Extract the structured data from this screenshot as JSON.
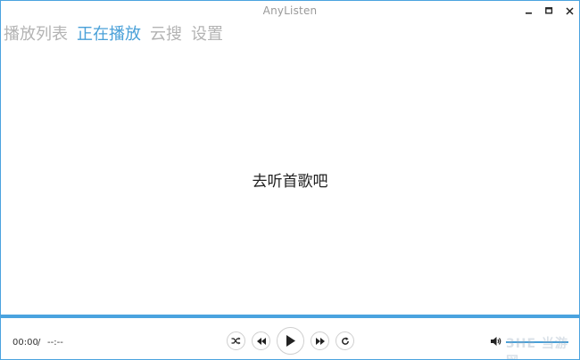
{
  "window": {
    "title": "AnyListen",
    "accent_color": "#4aa3df"
  },
  "controls": {
    "minimize_icon": "minimize-icon",
    "maximize_icon": "maximize-icon",
    "close_icon": "close-icon"
  },
  "tabs": [
    {
      "label": "播放列表",
      "active": false
    },
    {
      "label": "正在播放",
      "active": true
    },
    {
      "label": "云搜",
      "active": false
    },
    {
      "label": "设置",
      "active": false
    }
  ],
  "main": {
    "empty_message": "去听首歌吧"
  },
  "player": {
    "current_time": "00:00",
    "separator": "/",
    "total_time": "--:--",
    "progress": 1.0,
    "volume_level": 1.0,
    "buttons": [
      "shuffle-icon",
      "rewind-icon",
      "play-icon",
      "fast-forward-icon",
      "repeat-icon"
    ]
  },
  "watermark": {
    "text": "3HE 当游网"
  }
}
